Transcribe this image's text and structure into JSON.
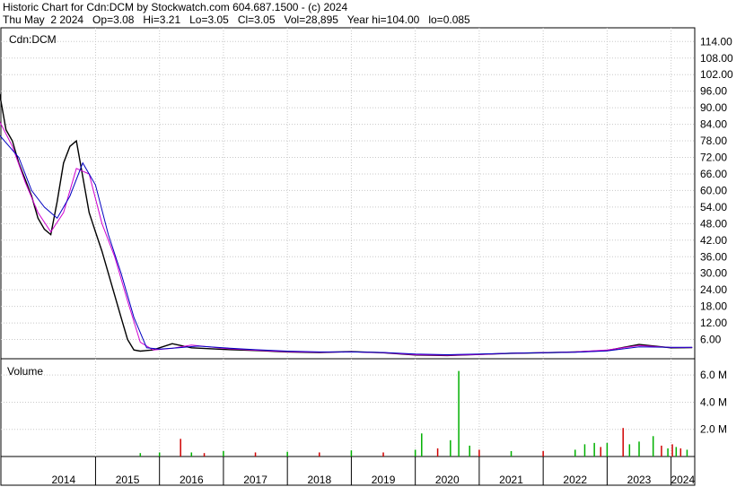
{
  "header": {
    "line1": "Historic Chart for Cdn:DCM by Stockwatch.com 604.687.1500 - (c) 2024",
    "line2": "Thu May  2 2024   Op=3.08   Hi=3.21   Lo=3.05   Cl=3.05   Vol=28,895   Year hi=104.00   lo=0.085"
  },
  "chart_data": [
    {
      "type": "candlestick",
      "title": "Cdn:DCM",
      "y_ticks": [
        "114.00",
        "108.00",
        "102.00",
        "96.00",
        "90.00",
        "84.00",
        "78.00",
        "72.00",
        "66.00",
        "60.00",
        "54.00",
        "48.00",
        "42.00",
        "36.00",
        "30.00",
        "24.00",
        "18.00",
        "12.00",
        "6.00"
      ],
      "ylim": [
        0,
        118
      ],
      "x_ticks": [
        "2014",
        "2015",
        "2016",
        "2017",
        "2018",
        "2019",
        "2020",
        "2021",
        "2022",
        "2023",
        "2024"
      ],
      "grid": true,
      "series": [
        {
          "name": "",
          "color": "#000000",
          "x": [
            2013.5,
            2013.6,
            2013.7,
            2013.8,
            2013.9,
            2014.0,
            2014.1,
            2014.2,
            2014.3,
            2014.4,
            2014.5,
            2014.6,
            2014.7,
            2014.8,
            2014.9,
            2015.0,
            2015.1,
            2015.2,
            2015.3,
            2015.4,
            2015.5,
            2015.6,
            2015.7,
            2015.8,
            2015.9,
            2016.0,
            2016.2,
            2016.5,
            2017.0,
            2017.5,
            2018.0,
            2018.5,
            2019.0,
            2019.5,
            2020.0,
            2020.5,
            2021.0,
            2021.5,
            2022.0,
            2022.5,
            2023.0,
            2023.5,
            2024.0,
            2024.33
          ],
          "values": [
            95,
            82,
            78,
            70,
            64,
            58,
            50,
            46,
            44,
            56,
            70,
            76,
            78,
            65,
            52,
            45,
            38,
            30,
            22,
            14,
            6,
            2.2,
            1.8,
            2.0,
            2.2,
            3.0,
            4.5,
            3.0,
            2.4,
            2.0,
            1.5,
            1.3,
            1.6,
            1.2,
            0.4,
            0.2,
            0.6,
            1.0,
            1.2,
            1.5,
            2.0,
            4.2,
            3.0,
            3.05
          ]
        },
        {
          "name": "",
          "color": "#d000d0",
          "x": [
            2013.5,
            2013.7,
            2013.9,
            2014.1,
            2014.3,
            2014.5,
            2014.7,
            2014.9,
            2015.1,
            2015.3,
            2015.5,
            2015.7,
            2015.9,
            2016.2,
            2016.5,
            2017.0,
            2017.5,
            2018.0,
            2018.5,
            2019.0,
            2019.5,
            2020.0,
            2020.5,
            2021.0,
            2021.5,
            2022.0,
            2022.5,
            2023.0,
            2023.5,
            2024.0,
            2024.33
          ],
          "values": [
            85,
            76,
            63,
            52,
            45,
            52,
            68,
            66,
            48,
            36,
            20,
            5,
            2.2,
            2.8,
            4.0,
            2.8,
            2.1,
            1.6,
            1.4,
            1.5,
            1.2,
            0.5,
            0.3,
            0.6,
            1.0,
            1.2,
            1.5,
            2.2,
            3.8,
            3.1,
            3.1
          ]
        },
        {
          "name": "",
          "color": "#0000c0",
          "x": [
            2013.5,
            2013.8,
            2014.0,
            2014.2,
            2014.4,
            2014.6,
            2014.8,
            2015.0,
            2015.2,
            2015.4,
            2015.6,
            2015.8,
            2016.0,
            2016.3,
            2016.6,
            2017.0,
            2017.5,
            2018.0,
            2018.5,
            2019.0,
            2019.5,
            2020.0,
            2020.5,
            2021.0,
            2021.5,
            2022.0,
            2022.5,
            2023.0,
            2023.5,
            2024.0,
            2024.33
          ],
          "values": [
            80,
            72,
            60,
            54,
            50,
            58,
            70,
            62,
            44,
            30,
            14,
            3,
            2.5,
            3.0,
            3.6,
            3.0,
            2.3,
            1.8,
            1.5,
            1.5,
            1.3,
            0.7,
            0.5,
            0.7,
            1.0,
            1.2,
            1.4,
            1.9,
            3.3,
            3.2,
            3.2
          ]
        }
      ]
    },
    {
      "type": "bar",
      "title": "Volume",
      "y_ticks": [
        "6.0 M",
        "4.0 M",
        "2.0 M"
      ],
      "ylim": [
        0,
        7.2
      ],
      "x": [
        2015.7,
        2016.0,
        2016.33,
        2016.5,
        2016.7,
        2017.0,
        2017.5,
        2018.0,
        2018.5,
        2019.0,
        2019.5,
        2020.0,
        2020.1,
        2020.35,
        2020.55,
        2020.68,
        2020.85,
        2021.0,
        2021.5,
        2022.0,
        2022.5,
        2022.65,
        2022.8,
        2022.9,
        2023.0,
        2023.25,
        2023.35,
        2023.5,
        2023.72,
        2023.85,
        2023.95,
        2024.02,
        2024.08,
        2024.15,
        2024.25
      ],
      "values": [
        0.25,
        0.3,
        1.3,
        0.3,
        0.25,
        0.4,
        0.3,
        0.35,
        0.3,
        0.45,
        0.3,
        0.5,
        1.7,
        0.6,
        1.2,
        6.3,
        0.8,
        0.5,
        0.4,
        0.4,
        0.5,
        0.9,
        1.0,
        0.7,
        1.0,
        2.1,
        0.9,
        1.1,
        1.5,
        0.8,
        0.6,
        0.9,
        0.7,
        0.6,
        0.5
      ],
      "colors": [
        "#00b000",
        "#00b000",
        "#d00000",
        "#00b000",
        "#d00000",
        "#00b000",
        "#d00000",
        "#00b000",
        "#d00000",
        "#00b000",
        "#d00000",
        "#00b000",
        "#00b000",
        "#d00000",
        "#00b000",
        "#00b000",
        "#00b000",
        "#d00000",
        "#00b000",
        "#d00000",
        "#00b000",
        "#00b000",
        "#00b000",
        "#d00000",
        "#00b000",
        "#d00000",
        "#00b000",
        "#00b000",
        "#00b000",
        "#d00000",
        "#00b000",
        "#d00000",
        "#00b000",
        "#d00000",
        "#00b000"
      ]
    }
  ]
}
